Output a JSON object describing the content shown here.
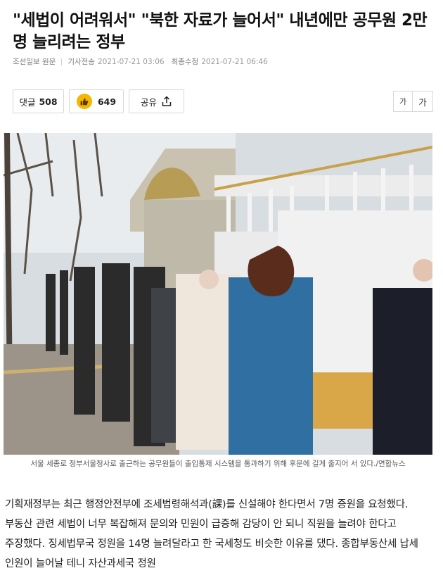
{
  "article": {
    "headline": "\"세법이 어려워서\" \"북한 자료가 늘어서\" 내년에만 공무원 2만명 늘리려는 정부",
    "source": "조선일보 원문",
    "sent_label": "기사전송",
    "sent_time": "2021-07-21 03:06",
    "modified_label": "최종수정",
    "modified_time": "2021-07-21 06:46",
    "caption": "서울 세종로 정부서울청사로 출근하는 공무원들이 출입통제 시스템을 통과하기 위해 후문에 길게 줄지어 서 있다./연합뉴스",
    "body": "기획재정부는 최근 행정안전부에 조세법령해석과(課)를 신설해야 한다면서 7명 증원을 요청했다. 부동산 관련 세법이 너무 복잡해져 문의와 민원이 급증해 감당이 안 되니 직원을 늘려야 한다고 주장했다. 징세법무국 정원을 14명 늘려달라고 한 국세청도 비슷한 이유를 댔다. 종합부동산세 납세 인원이 늘어날 테니 자산과세국 정원"
  },
  "actions": {
    "comment_label": "댓글",
    "comment_count": "508",
    "react_count": "649",
    "share_label": "공유",
    "font_small": "가",
    "font_large": "가"
  },
  "icons": {
    "react": "thumb-up-icon",
    "share": "share-upload-icon",
    "photo": "people-queue-photo"
  },
  "colors": {
    "react_badge": "#f6b600"
  }
}
